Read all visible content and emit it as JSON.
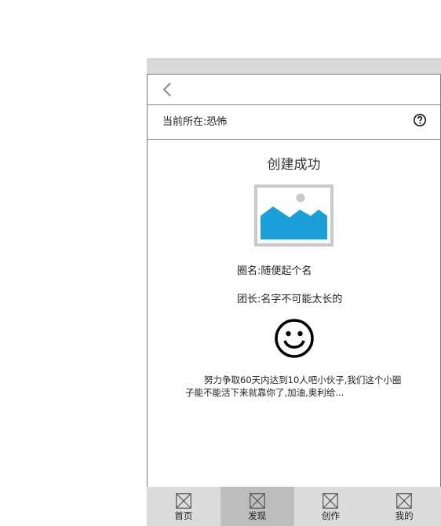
{
  "location": {
    "text": "当前所在:恐怖"
  },
  "main": {
    "title": "创建成功",
    "circle_name": "圈名:随便起个名",
    "leader": "团长:名字不可能太长的",
    "description": "努力争取60天内达到10人吧小伙子,我们这个小圈子能不能活下来就靠你了,加油,奥利给..."
  },
  "tabbar": {
    "tabs": [
      {
        "label": "首页"
      },
      {
        "label": "发现"
      },
      {
        "label": "创作"
      },
      {
        "label": "我的"
      }
    ],
    "active": "发现"
  },
  "colors": {
    "image_fill": "#1a9fd9",
    "tabbar_bg": "#dcdcdc",
    "tab_active_bg": "#bdbdbd",
    "statusbar_bg": "#d9d9d9"
  },
  "icons": [
    "back-arrow-icon",
    "help-icon",
    "image-icon",
    "smiley-icon",
    "tab-placeholder-icon"
  ]
}
